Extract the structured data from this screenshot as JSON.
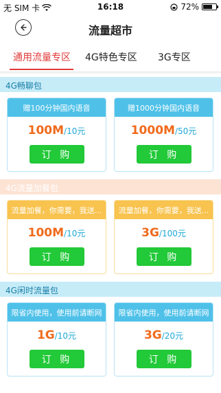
{
  "status": {
    "carrier": "无 SIM 卡",
    "time": "16:18",
    "battery": "72%",
    "battery_level": 0.72
  },
  "nav": {
    "title": "流量超市",
    "back_icon": "back-arrow-icon"
  },
  "tabs": [
    {
      "label": "通用流量专区",
      "active": true
    },
    {
      "label": "4G特色专区",
      "active": false
    },
    {
      "label": "3G专区",
      "active": false
    }
  ],
  "sections": [
    {
      "title": "4G畅聊包",
      "header_bg": "#c6ecf8",
      "header_color": "#1a7fa8",
      "card_top_bg": "#4fc1e9",
      "card_border": "#b9e3f2",
      "cards": [
        {
          "top": "赠100分钟国内语音",
          "amount": "100M",
          "unit": "/10元",
          "button": "订 购"
        },
        {
          "top": "赠1000分钟国内语音",
          "amount": "1000M",
          "unit": "/50元",
          "button": "订 购"
        }
      ]
    },
    {
      "title": "4G流量加餐包",
      "header_bg": "#fde3d4",
      "header_color": "#ffffff",
      "card_top_bg": "#f8c34e",
      "card_border": "#f8dd9a",
      "cards": [
        {
          "top": "流量加餐，你需要，我送...",
          "amount": "100M",
          "unit": "/10元",
          "button": "订 购"
        },
        {
          "top": "流量加餐，你需要，我送...",
          "amount": "3G",
          "unit": "/100元",
          "button": "订 购"
        }
      ]
    },
    {
      "title": "4G闲时流量包",
      "header_bg": "#c6ecf8",
      "header_color": "#1a7fa8",
      "card_top_bg": "#4fc1e9",
      "card_border": "#b9e3f2",
      "cards": [
        {
          "top": "限省内使用，使用前请断网",
          "amount": "1G",
          "unit": "/10元",
          "button": "订 购"
        },
        {
          "top": "限省内使用，使用前请断网",
          "amount": "3G",
          "unit": "/20元",
          "button": "订 购"
        }
      ]
    }
  ]
}
